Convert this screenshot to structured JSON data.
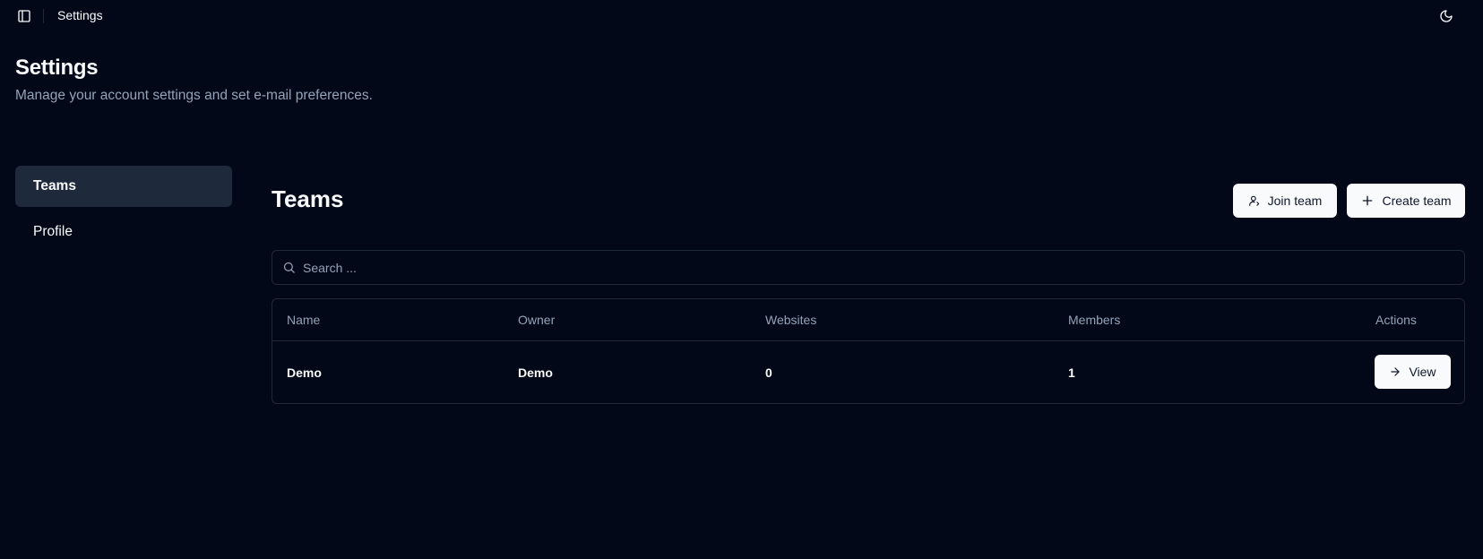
{
  "topbar": {
    "title": "Settings",
    "sidebar_toggle_icon": "panel-left-icon",
    "theme_toggle_icon": "moon-icon"
  },
  "header": {
    "title": "Settings",
    "subtitle": "Manage your account settings and set e-mail preferences."
  },
  "nav": {
    "items": [
      {
        "label": "Teams",
        "active": true
      },
      {
        "label": "Profile",
        "active": false
      }
    ]
  },
  "teams": {
    "title": "Teams",
    "join_label": "Join team",
    "create_label": "Create team",
    "search_placeholder": "Search ...",
    "columns": [
      "Name",
      "Owner",
      "Websites",
      "Members",
      "Actions"
    ],
    "rows": [
      {
        "name": "Demo",
        "owner": "Demo",
        "websites": "0",
        "members": "1",
        "action_label": "View"
      }
    ]
  },
  "colors": {
    "background": "#020817",
    "border": "#1e293b",
    "muted_text": "#94a3b8",
    "button_bg": "#f8fafc"
  }
}
